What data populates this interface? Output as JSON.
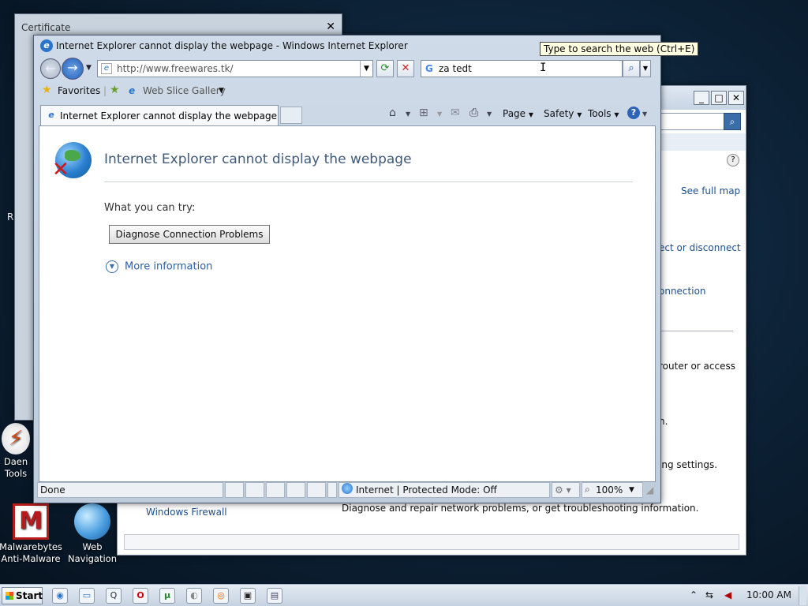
{
  "desktop": {
    "icons": [
      {
        "label1": "Daen",
        "label2": "Tools"
      },
      {
        "label1": "Malwarebytes",
        "label2": "Anti-Malware"
      },
      {
        "label1": "Web",
        "label2": "Navigation"
      }
    ],
    "edge_letters": [
      "R"
    ]
  },
  "certificate_window": {
    "title": "Certificate",
    "close": "✕"
  },
  "network_window": {
    "see_full_map": "See full map",
    "connect_disconnect": "ect or disconnect",
    "connection": "onnection",
    "router": "router or access",
    "n_dot": "n.",
    "sharing": "ing settings.",
    "firewall": "Windows Firewall",
    "diagnose_desc": "Diagnose and repair network problems, or get troubleshooting information."
  },
  "ie": {
    "title": "Internet Explorer cannot display the webpage - Windows Internet Explorer",
    "address": "http://www.freewares.tk/",
    "search_value": "za tedt",
    "favorites": "Favorites",
    "web_slice": "Web Slice Gallery",
    "tab_label": "Internet Explorer cannot display the webpage",
    "cmd": {
      "page": "Page",
      "safety": "Safety",
      "tools": "Tools"
    },
    "content": {
      "heading": "Internet Explorer cannot display the webpage",
      "try": "What you can try:",
      "diagnose_button": "Diagnose Connection Problems",
      "more_info": "More information"
    },
    "status": {
      "done": "Done",
      "zone": "Internet | Protected Mode: Off",
      "zoom": "100%"
    }
  },
  "tooltip": "Type to search the web (Ctrl+E)",
  "taskbar": {
    "start": "Start",
    "clock": "10:00 AM"
  }
}
